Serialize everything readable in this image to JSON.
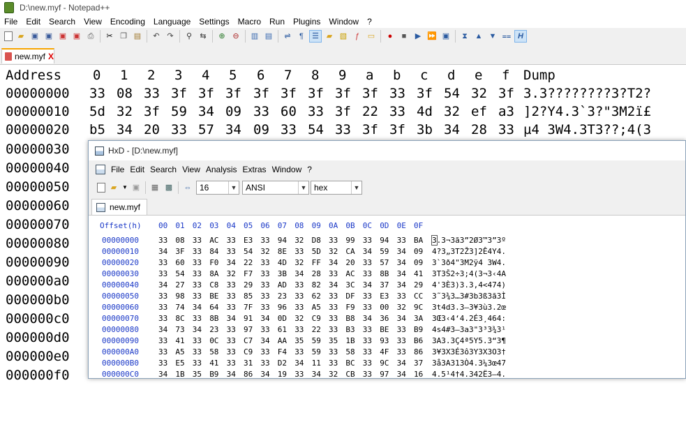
{
  "npp": {
    "title": "D:\\new.myf - Notepad++",
    "menu": [
      "File",
      "Edit",
      "Search",
      "View",
      "Encoding",
      "Language",
      "Settings",
      "Macro",
      "Run",
      "Plugins",
      "Window",
      "?"
    ],
    "tab": {
      "label": "new.myf",
      "close": "X"
    },
    "header": {
      "address": "Address",
      "cols": [
        "0",
        "1",
        "2",
        "3",
        "4",
        "5",
        "6",
        "7",
        "8",
        "9",
        "a",
        "b",
        "c",
        "d",
        "e",
        "f"
      ],
      "dump": "Dump"
    },
    "rows": [
      {
        "addr": "00000000",
        "bytes": [
          "33",
          "08",
          "33",
          "3f",
          "3f",
          "3f",
          "3f",
          "3f",
          "3f",
          "3f",
          "3f",
          "33",
          "3f",
          "54",
          "32",
          "3f"
        ],
        "dump": "3.3????????3?T2?"
      },
      {
        "addr": "00000010",
        "bytes": [
          "5d",
          "32",
          "3f",
          "59",
          "34",
          "09",
          "33",
          "60",
          "33",
          "3f",
          "22",
          "33",
          "4d",
          "32",
          "ef",
          "a3"
        ],
        "dump": "]2?Y4.3`3?\"3M2ï£"
      },
      {
        "addr": "00000020",
        "bytes": [
          "b5",
          "34",
          "20",
          "33",
          "57",
          "34",
          "09",
          "33",
          "54",
          "33",
          "3f",
          "3f",
          "3b",
          "34",
          "28",
          "33"
        ],
        "dump": "µ4 3W4.3T3??;4(3"
      }
    ],
    "extra_addrs": [
      "00000030",
      "00000040",
      "00000050",
      "00000060",
      "00000070",
      "00000080",
      "00000090",
      "000000a0",
      "000000b0",
      "000000c0",
      "000000d0",
      "000000e0",
      "000000f0"
    ]
  },
  "hxd": {
    "title": "HxD - [D:\\new.myf]",
    "menu": [
      "File",
      "Edit",
      "Search",
      "View",
      "Analysis",
      "Extras",
      "Window",
      "?"
    ],
    "toolbar": {
      "bytes_per_row": "16",
      "charset": "ANSI",
      "display": "hex"
    },
    "tab": {
      "label": "new.myf"
    },
    "offset_label": "Offset(h)",
    "cols": [
      "00",
      "01",
      "02",
      "03",
      "04",
      "05",
      "06",
      "07",
      "08",
      "09",
      "0A",
      "0B",
      "0C",
      "0D",
      "0E",
      "0F"
    ],
    "rows": [
      {
        "addr": "00000000",
        "bytes": [
          "33",
          "08",
          "33",
          "AC",
          "33",
          "E3",
          "33",
          "94",
          "32",
          "D8",
          "33",
          "99",
          "33",
          "94",
          "33",
          "BA"
        ],
        "text": "3.3¬3ã3”2Ø3™3”3º"
      },
      {
        "addr": "00000010",
        "bytes": [
          "34",
          "3F",
          "33",
          "84",
          "33",
          "54",
          "32",
          "8E",
          "33",
          "5D",
          "32",
          "CA",
          "34",
          "59",
          "34",
          "09"
        ],
        "text": "4?3„3T2Ž3]2Ê4Y4."
      },
      {
        "addr": "00000020",
        "bytes": [
          "33",
          "60",
          "33",
          "F0",
          "34",
          "22",
          "33",
          "4D",
          "32",
          "FF",
          "34",
          "20",
          "33",
          "57",
          "34",
          "09"
        ],
        "text": "3`3ð4\"3M2ÿ4 3W4."
      },
      {
        "addr": "00000030",
        "bytes": [
          "33",
          "54",
          "33",
          "8A",
          "32",
          "F7",
          "33",
          "3B",
          "34",
          "28",
          "33",
          "AC",
          "33",
          "8B",
          "34",
          "41"
        ],
        "text": "3T3Š2÷3;4(3¬3‹4A"
      },
      {
        "addr": "00000040",
        "bytes": [
          "34",
          "27",
          "33",
          "C8",
          "33",
          "29",
          "33",
          "AD",
          "33",
          "82",
          "34",
          "3C",
          "34",
          "37",
          "34",
          "29"
        ],
        "text": "4'3È3)3.3‚4<474)"
      },
      {
        "addr": "00000050",
        "bytes": [
          "33",
          "98",
          "33",
          "BE",
          "33",
          "85",
          "33",
          "23",
          "33",
          "62",
          "33",
          "DF",
          "33",
          "E3",
          "33",
          "CC"
        ],
        "text": "3˜3¾3…3#3b3ß3ã3Ì"
      },
      {
        "addr": "00000060",
        "bytes": [
          "33",
          "74",
          "34",
          "64",
          "33",
          "7F",
          "33",
          "96",
          "33",
          "A5",
          "33",
          "F9",
          "33",
          "00",
          "32",
          "9C"
        ],
        "text": "3t4d3.3–3¥3ù3.2œ"
      },
      {
        "addr": "00000070",
        "bytes": [
          "33",
          "8C",
          "33",
          "8B",
          "34",
          "91",
          "34",
          "0D",
          "32",
          "C9",
          "33",
          "B8",
          "34",
          "36",
          "34",
          "3A"
        ],
        "text": "3Œ3‹4‘4.2É3¸464:"
      },
      {
        "addr": "00000080",
        "bytes": [
          "34",
          "73",
          "34",
          "23",
          "33",
          "97",
          "33",
          "61",
          "33",
          "22",
          "33",
          "B3",
          "33",
          "BE",
          "33",
          "B9"
        ],
        "text": "4s4#3—3a3\"3³3¾3¹"
      },
      {
        "addr": "00000090",
        "bytes": [
          "33",
          "41",
          "33",
          "0C",
          "33",
          "C7",
          "34",
          "AA",
          "35",
          "59",
          "35",
          "1B",
          "33",
          "93",
          "33",
          "B6"
        ],
        "text": "3A3.3Ç4ª5Y5.3“3¶"
      },
      {
        "addr": "000000A0",
        "bytes": [
          "33",
          "A5",
          "33",
          "58",
          "33",
          "C9",
          "33",
          "F4",
          "33",
          "59",
          "33",
          "58",
          "33",
          "4F",
          "33",
          "86"
        ],
        "text": "3¥3X3É3ô3Y3X3O3†"
      },
      {
        "addr": "000000B0",
        "bytes": [
          "33",
          "E5",
          "33",
          "41",
          "33",
          "31",
          "33",
          "D2",
          "34",
          "11",
          "33",
          "BC",
          "33",
          "9C",
          "34",
          "37"
        ],
        "text": "3å3A313Ò4.3¼3œ47"
      },
      {
        "addr": "000000C0",
        "bytes": [
          "34",
          "1B",
          "35",
          "B9",
          "34",
          "86",
          "34",
          "19",
          "33",
          "34",
          "32",
          "CB",
          "33",
          "97",
          "34",
          "16"
        ],
        "text": "4.5¹4†4.342Ë3—4."
      }
    ]
  }
}
